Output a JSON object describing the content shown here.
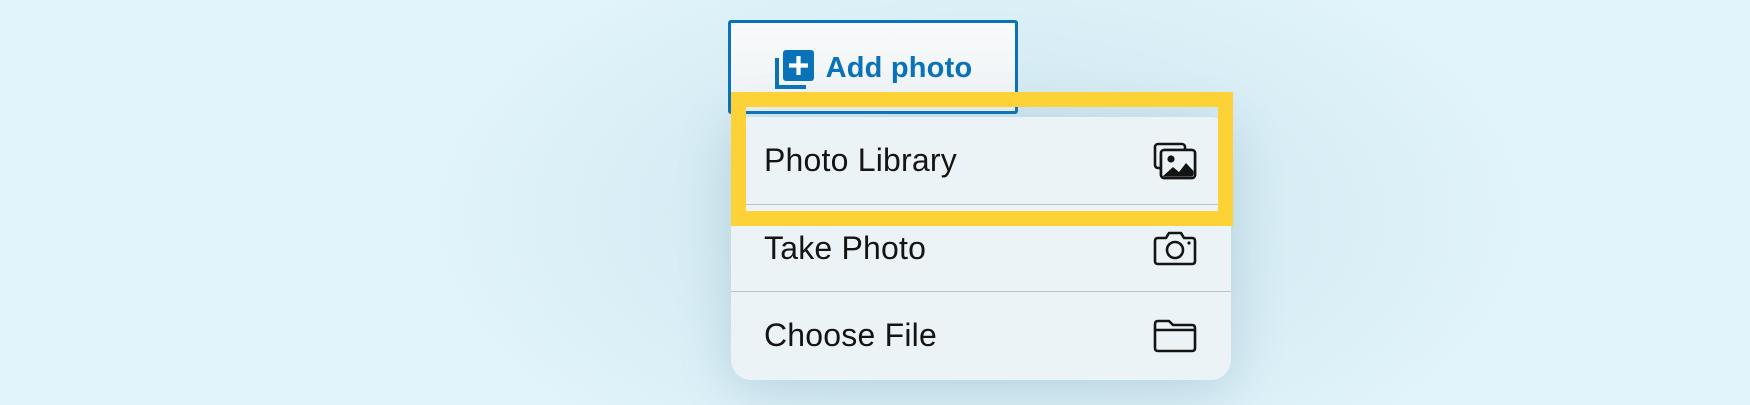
{
  "add_photo_button": {
    "label": "Add photo",
    "icon": "add-photo-icon",
    "color": "#0a72b8"
  },
  "menu": {
    "items": [
      {
        "label": "Photo Library",
        "icon": "photo-library-icon"
      },
      {
        "label": "Take Photo",
        "icon": "camera-icon"
      },
      {
        "label": "Choose File",
        "icon": "folder-icon"
      }
    ]
  },
  "highlight": {
    "color": "#fdd236",
    "target": "Photo Library"
  }
}
